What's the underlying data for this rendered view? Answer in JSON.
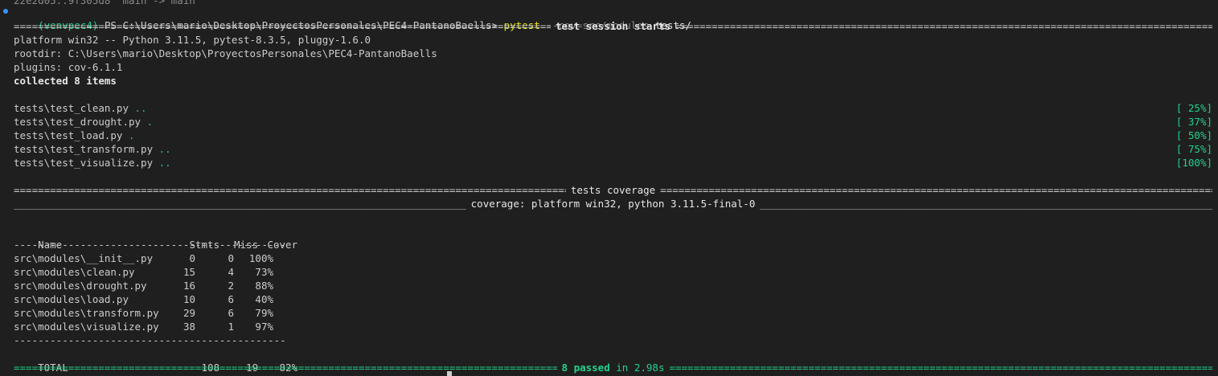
{
  "prev_line": "22e2d05..9f305d8  main -> main",
  "prompt": {
    "venv": "(venvpec4)",
    "ps": "PS C:\\Users\\mario\\Desktop\\ProyectosPersonales\\PEC4-PantanoBaells>",
    "cmd": "pytest",
    "arg_opt": "--cov=src/modules",
    "arg_path": "tests/"
  },
  "session": {
    "title": "test session starts",
    "platform": "platform win32 -- Python 3.11.5, pytest-8.3.5, pluggy-1.6.0",
    "rootdir": "rootdir: C:\\Users\\mario\\Desktop\\ProyectosPersonales\\PEC4-PantanoBaells",
    "plugins": "plugins: cov-6.1.1",
    "collected": "collected 8 items"
  },
  "tests": [
    {
      "file": "tests\\test_clean.py",
      "dots": "..",
      "pct": "[ 25%]"
    },
    {
      "file": "tests\\test_drought.py",
      "dots": ".",
      "pct": "[ 37%]"
    },
    {
      "file": "tests\\test_load.py",
      "dots": ".",
      "pct": "[ 50%]"
    },
    {
      "file": "tests\\test_transform.py",
      "dots": "..",
      "pct": "[ 75%]"
    },
    {
      "file": "tests\\test_visualize.py",
      "dots": "..",
      "pct": "[100%]"
    }
  ],
  "coverage_title": "tests coverage",
  "coverage_subtitle": "coverage: platform win32, python 3.11.5-final-0",
  "coverage_table": {
    "headers": [
      "Name",
      "Stmts",
      "Miss",
      "Cover"
    ],
    "separator": "---------------------------------------------",
    "rows": [
      [
        "src\\modules\\__init__.py",
        "0",
        "0",
        "100%"
      ],
      [
        "src\\modules\\clean.py",
        "15",
        "4",
        "73%"
      ],
      [
        "src\\modules\\drought.py",
        "16",
        "2",
        "88%"
      ],
      [
        "src\\modules\\load.py",
        "10",
        "6",
        "40%"
      ],
      [
        "src\\modules\\transform.py",
        "29",
        "6",
        "79%"
      ],
      [
        "src\\modules\\visualize.py",
        "38",
        "1",
        "97%"
      ]
    ],
    "total": [
      "TOTAL",
      "108",
      "19",
      "82%"
    ]
  },
  "summary": {
    "passed": "8 passed",
    "time": "in 2.98s"
  },
  "colors": {
    "background": "#1f1f1f",
    "text": "#cccccc",
    "green": "#23d18b",
    "cyan": "#2fb9b9",
    "yellow": "#e5e510"
  }
}
